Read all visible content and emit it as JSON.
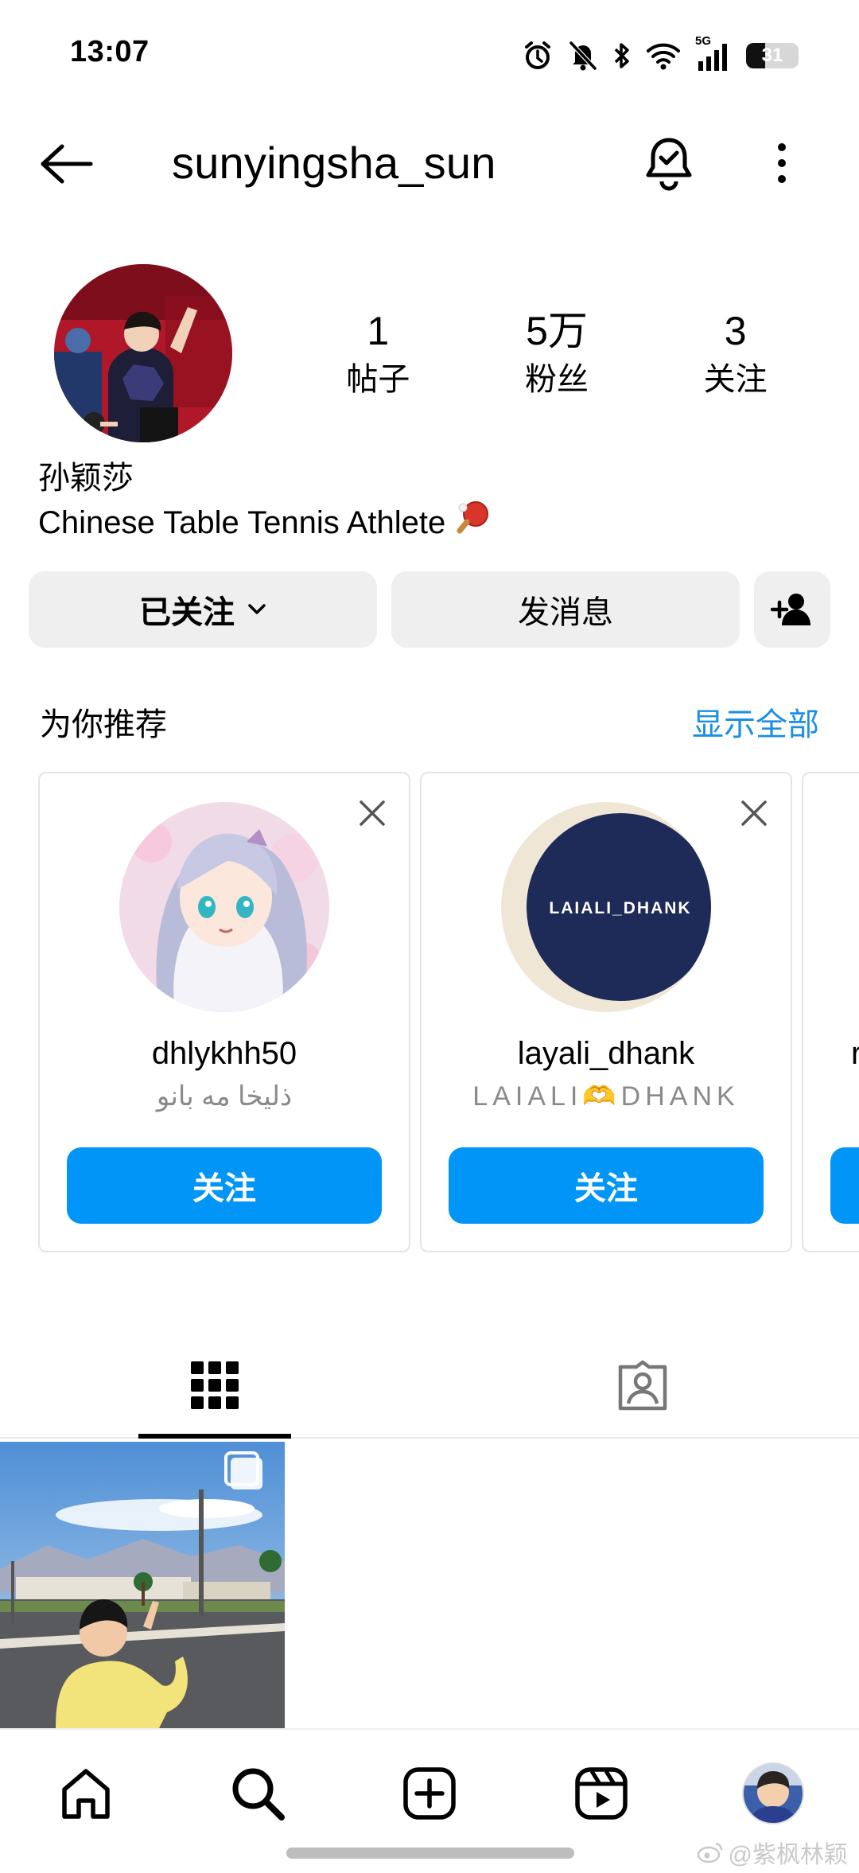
{
  "status_bar": {
    "time": "13:07",
    "network": "5G",
    "battery": "31",
    "icons": [
      "alarm-icon",
      "mute-icon",
      "bluetooth-icon",
      "wifi-icon",
      "signal-icon",
      "battery-icon"
    ]
  },
  "header": {
    "username": "sunyingsha_sun",
    "icons": [
      "back-arrow-icon",
      "notification-bell-icon",
      "more-vertical-icon"
    ]
  },
  "profile": {
    "stats": [
      {
        "value": "1",
        "label": "帖子"
      },
      {
        "value": "5万",
        "label": "粉丝"
      },
      {
        "value": "3",
        "label": "关注"
      }
    ],
    "display_name": "孙颖莎",
    "bio": "Chinese Table Tennis Athlete"
  },
  "actions": {
    "follow_label": "已关注",
    "message_label": "发消息"
  },
  "suggestions": {
    "title": "为你推荐",
    "see_all": "显示全部",
    "cards": [
      {
        "username": "dhlykhh50",
        "subtitle": "ذليخا مه بانو",
        "follow_label": "关注"
      },
      {
        "username": "layali_dhank",
        "subtitle": "LAIALI🫶DHANK",
        "follow_label": "关注",
        "avatar_text": "LAIALI_DHANK"
      }
    ]
  },
  "tabs": [
    "grid-tab",
    "tagged-tab"
  ],
  "nav": [
    "home-icon",
    "search-icon",
    "create-post-icon",
    "reels-icon",
    "profile-avatar"
  ],
  "watermark": "@紫枫林颖",
  "colors": {
    "accent": "#0095f6",
    "link": "#1a8fe3",
    "button_bg": "#efeff0"
  }
}
